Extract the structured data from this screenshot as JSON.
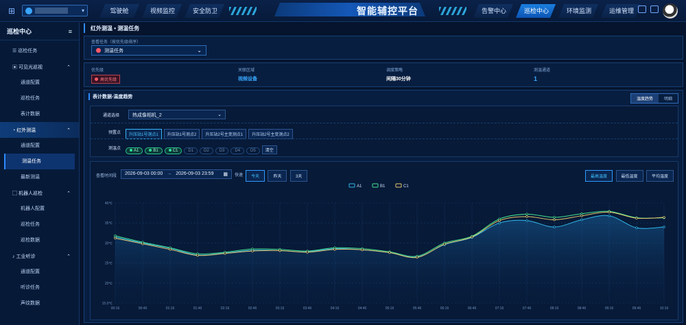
{
  "header": {
    "title": "智能辅控平台",
    "left_tabs": [
      "驾驶舱",
      "视频监控",
      "安全防卫"
    ],
    "right_tabs": [
      "告警中心",
      "巡检中心",
      "环境监测",
      "运维管理"
    ],
    "active_right_tab": 1
  },
  "sidebar": {
    "title": "巡检中心",
    "items": {
      "tasks": "巡检任务",
      "visible": "可见光巡视",
      "visible_sub": [
        "通道配置",
        "巡检任务",
        "表计数据"
      ],
      "ir": "红外测温",
      "ir_sub": [
        "通道配置",
        "测温任务",
        "最新测温"
      ],
      "robot": "机器人巡检",
      "robot_sub": [
        "机器人配置",
        "巡检任务",
        "巡检数据"
      ],
      "audio": "工业听诊",
      "audio_sub": [
        "通道配置",
        "听诊任务",
        "声纹数据"
      ]
    }
  },
  "main": {
    "breadcrumb": "红外测温 • 测温任务",
    "task_label": "查看任务（按优先级排序）",
    "task_value": "测温任务",
    "priority_label": "优先级",
    "priority_value": "高优先级",
    "area_label": "关联区域",
    "area_value": "视频设备",
    "strategy_label": "调度策略",
    "strategy_value": "间隔30分钟",
    "channels_label": "测温通道",
    "channels_value": "1",
    "trend_title": "表计数据-温度趋势",
    "view_toggle": [
      "温度趋势",
      "明细"
    ],
    "channel_select_label": "通道选择",
    "channel_select_value": "热成像相机_2",
    "preset_label": "预置点",
    "presets": [
      "升压站1号测点1",
      "升压站1号测点2",
      "升压站2号主变测点1",
      "升压站2号主变测点2"
    ],
    "point_label": "测温点",
    "points": [
      "A1",
      "B1",
      "C1",
      "D1",
      "D2",
      "D3",
      "D4",
      "D5"
    ],
    "clear_label": "清空",
    "time_label": "查看时间段",
    "time_start": "2026-09-03 00:00",
    "time_sep": "→",
    "time_end": "2026-09-03 23:59",
    "quick_label": "快速",
    "quick": [
      "今天",
      "昨天",
      "3天"
    ],
    "metric_btns": [
      "最高温度",
      "最低温度",
      "平均温度"
    ]
  },
  "chart_data": {
    "type": "line",
    "x": [
      "00:16",
      "00:46",
      "01:16",
      "01:46",
      "02:16",
      "02:46",
      "03:16",
      "03:46",
      "04:16",
      "04:46",
      "05:16",
      "05:46",
      "06:16",
      "06:46",
      "07:16",
      "07:46",
      "08:16",
      "08:46",
      "09:16",
      "09:46",
      "10:16"
    ],
    "yticks": [
      "40℃",
      "35℃",
      "30℃",
      "25℃",
      "20℃",
      "15.0℃"
    ],
    "ylim": [
      15,
      40
    ],
    "legend_position": "top-center",
    "series": [
      {
        "name": "A1",
        "color": "#30b7e8",
        "values": [
          31.5,
          30.0,
          28.7,
          27.0,
          27.5,
          28.2,
          28.1,
          27.8,
          28.6,
          28.3,
          27.6,
          26.5,
          29.6,
          31.4,
          35.0,
          35.6,
          34.0,
          35.8,
          36.8,
          33.8,
          34.0
        ]
      },
      {
        "name": "B1",
        "color": "#46e08e",
        "values": [
          31.8,
          30.2,
          28.8,
          27.3,
          27.7,
          28.5,
          28.4,
          28.0,
          28.8,
          28.6,
          27.8,
          26.7,
          30.0,
          31.7,
          36.0,
          37.2,
          36.4,
          37.3,
          37.9,
          36.3,
          36.3
        ]
      },
      {
        "name": "C1",
        "color": "#e7c86a",
        "values": [
          31.2,
          29.8,
          28.4,
          26.9,
          27.4,
          28.0,
          28.1,
          27.7,
          28.4,
          28.3,
          27.6,
          26.4,
          29.7,
          31.5,
          35.6,
          36.6,
          35.8,
          36.8,
          37.7,
          36.2,
          36.4
        ]
      }
    ]
  }
}
